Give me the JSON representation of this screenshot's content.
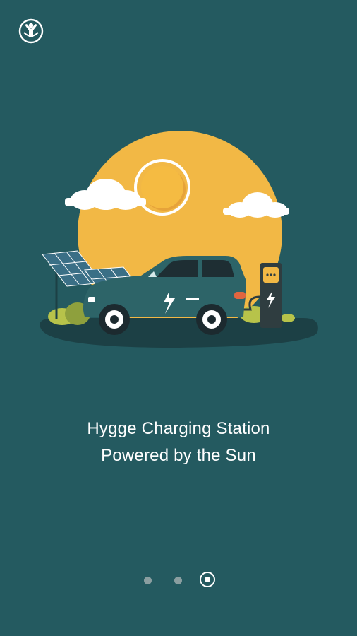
{
  "app": {
    "logo_icon": "person-globe-logo-icon"
  },
  "onboarding": {
    "illustration_icon": "solar-charging-car-illustration",
    "caption_line1": "Hygge Charging Station",
    "caption_line2": "Powered by the Sun"
  },
  "pager": {
    "page_count": 3,
    "active_index": 3
  },
  "colors": {
    "background": "#245a60",
    "sun": "#f2b845",
    "car": "#2d6468",
    "text": "#ffffff"
  }
}
